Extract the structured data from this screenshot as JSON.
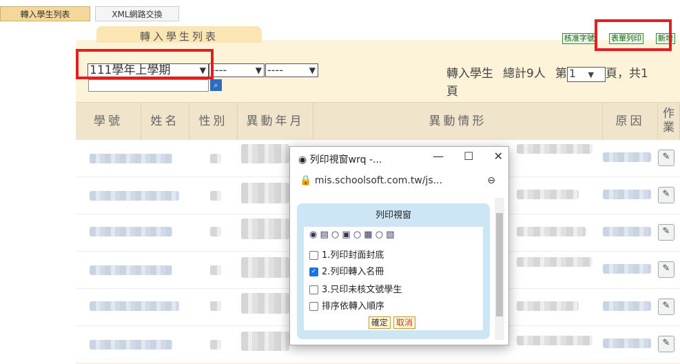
{
  "tabs": [
    "轉入學生列表",
    "XML網路交換"
  ],
  "panel_tab": "轉入學生列表",
  "toolbar": {
    "btn_approve": "核准字號",
    "btn_print": "表單列印",
    "btn_new": "新增"
  },
  "filters": {
    "semester": "111學年上學期",
    "select2": "----",
    "select3": "----"
  },
  "summary": {
    "label": "轉入學生",
    "total": "總計9人",
    "page_prefix": "第",
    "page_value": "1",
    "page_suffix": "頁，共1",
    "page_tail": "頁"
  },
  "table": {
    "headers": [
      "學號",
      "姓名",
      "性別",
      "異動年月",
      "異動情形",
      "原因",
      "作業"
    ]
  },
  "popup": {
    "title": "列印視窗wrq -...",
    "url": "mis.schoolsoft.com.tw/js...",
    "heading": "列印視窗",
    "options": [
      "1.列印封面封底",
      "2.列印轉入名冊",
      "3.只印未核文號學生",
      "排序依轉入順序"
    ],
    "checked": [
      false,
      true,
      false,
      false
    ],
    "confirm": "確定",
    "cancel": "取消"
  },
  "colors": {
    "highlight": "#e41e1e",
    "panel_bg": "#fdf3d8",
    "header_bg": "#f0e4cb",
    "popup_bg": "#cde6f5"
  }
}
